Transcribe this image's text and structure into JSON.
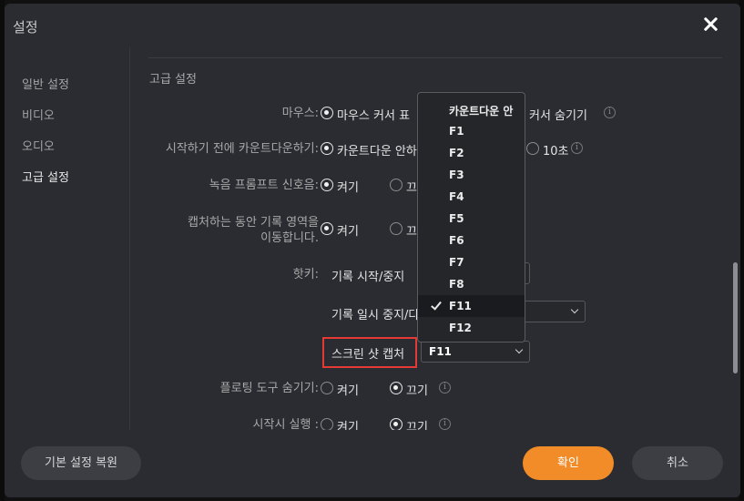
{
  "window": {
    "title": "설정"
  },
  "sidebar": {
    "items": [
      {
        "label": "일반 설정"
      },
      {
        "label": "비디오"
      },
      {
        "label": "오디오"
      },
      {
        "label": "고급 설정"
      }
    ]
  },
  "section": {
    "title": "고급 설정"
  },
  "settings": {
    "mouse": {
      "label": "마우스:",
      "option1": "마우스 커서 표",
      "option2": "커서 숨기기"
    },
    "countdown": {
      "label": "시작하기 전에 카운트다운하기:",
      "option1": "카운트다운 안하",
      "option2": "10초"
    },
    "prompt": {
      "label": "녹음 프롬프트 신호음:",
      "on": "켜기",
      "off": "끄"
    },
    "move_area": {
      "label_line1": "캡처하는 동안 기록 영역을",
      "label_line2": "이동합니다.",
      "on": "켜기",
      "off": "끄"
    },
    "hotkey": {
      "label": "핫키:",
      "start_stop": "기록 시작/중지",
      "pause": "기록 일시 중지/다",
      "screenshot": "스크린 샷 캡처",
      "screenshot_value": "F11"
    },
    "floating": {
      "label": "플로팅 도구 숨기기:",
      "on": "켜기",
      "off": "끄기"
    },
    "startup": {
      "label": "시작시 실행 :",
      "on": "켜기",
      "off": "끄기"
    }
  },
  "dropdown": {
    "options": [
      "카운트다운 안",
      "F1",
      "F2",
      "F3",
      "F4",
      "F5",
      "F6",
      "F7",
      "F8",
      "F11",
      "F12"
    ],
    "selected": "F11"
  },
  "footer": {
    "reset_label": "기본 설정 복원",
    "ok_label": "확인",
    "cancel_label": "취소"
  },
  "colors": {
    "accent": "#f28c28",
    "highlight": "#e53935",
    "background": "#2a2c31"
  },
  "icons": {
    "close": "close-icon",
    "info": "info-icon",
    "chevron": "chevron-down-icon",
    "check": "check-icon"
  }
}
